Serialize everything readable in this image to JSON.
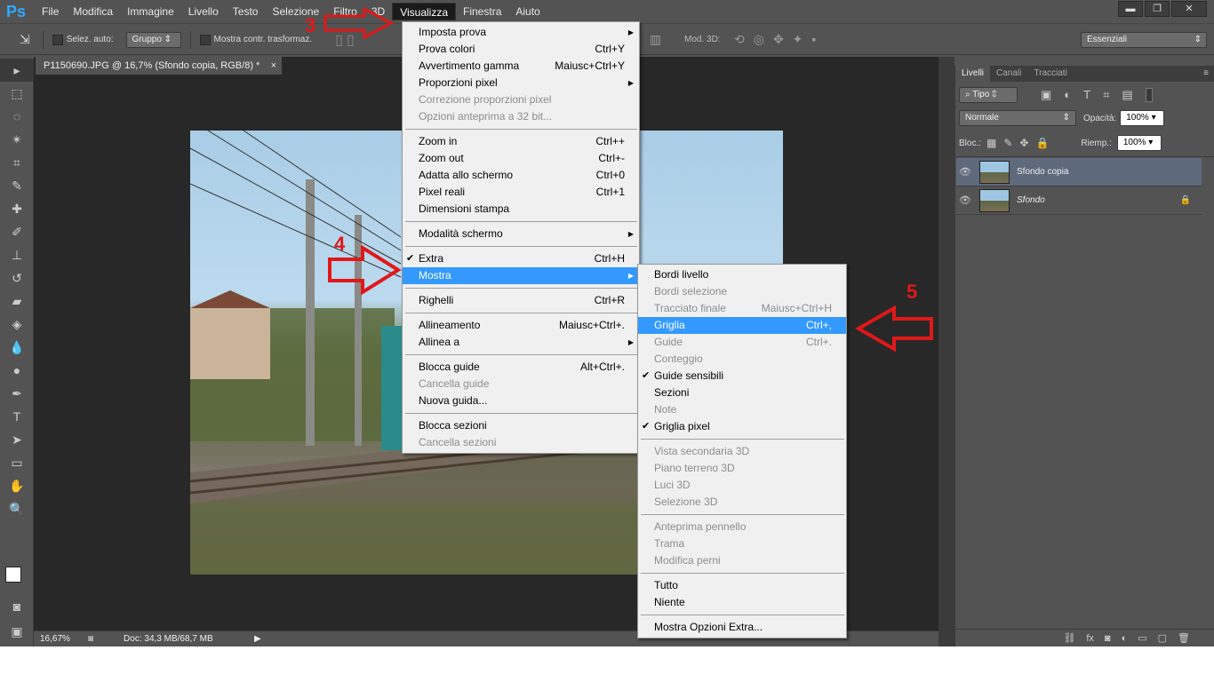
{
  "app": {
    "logo": "Ps"
  },
  "menubar": {
    "items": [
      "File",
      "Modifica",
      "Immagine",
      "Livello",
      "Testo",
      "Selezione",
      "Filtro",
      "3D",
      "Visualizza",
      "Finestra",
      "Aiuto"
    ]
  },
  "window_controls": {
    "minimize": "▬",
    "restore": "❐",
    "close": "✕"
  },
  "options_bar": {
    "auto_select_label": "Selez. auto:",
    "auto_select_value": "Gruppo",
    "show_transform_label": "Mostra contr. trasformaz.",
    "mode3d_label": "Mod. 3D:",
    "workspace": "Essenziali"
  },
  "document": {
    "tab_title": "P1150690.JPG @ 16,7% (Sfondo copia, RGB/8) *",
    "tab_close": "×"
  },
  "status": {
    "zoom": "16,67%",
    "doc": "Doc: 34,3 MB/68,7 MB"
  },
  "layers_panel": {
    "tabs": [
      "Livelli",
      "Canali",
      "Tracciati"
    ],
    "filter": "Tipo",
    "blend_mode": "Normale",
    "opacity_label": "Opacità:",
    "opacity_value": "100%",
    "lock_label": "Bloc.:",
    "fill_label": "Riemp.:",
    "fill_value": "100%",
    "layers": [
      {
        "name": "Sfondo copia"
      },
      {
        "name": "Sfondo"
      }
    ]
  },
  "view_menu": {
    "items": [
      {
        "label": "Imposta prova",
        "shortcut": "",
        "submenu": true
      },
      {
        "label": "Prova colori",
        "shortcut": "Ctrl+Y"
      },
      {
        "label": "Avvertimento gamma",
        "shortcut": "Maiusc+Ctrl+Y"
      },
      {
        "label": "Proporzioni pixel",
        "shortcut": "",
        "submenu": true
      },
      {
        "label": "Correzione proporzioni pixel",
        "shortcut": "",
        "disabled": true
      },
      {
        "label": "Opzioni anteprima a 32 bit...",
        "shortcut": "",
        "disabled": true
      },
      {
        "sep": true
      },
      {
        "label": "Zoom in",
        "shortcut": "Ctrl++"
      },
      {
        "label": "Zoom out",
        "shortcut": "Ctrl+-"
      },
      {
        "label": "Adatta allo schermo",
        "shortcut": "Ctrl+0"
      },
      {
        "label": "Pixel reali",
        "shortcut": "Ctrl+1"
      },
      {
        "label": "Dimensioni stampa",
        "shortcut": ""
      },
      {
        "sep": true
      },
      {
        "label": "Modalità schermo",
        "shortcut": "",
        "submenu": true
      },
      {
        "sep": true
      },
      {
        "label": "Extra",
        "shortcut": "Ctrl+H",
        "checked": true
      },
      {
        "label": "Mostra",
        "shortcut": "",
        "submenu": true,
        "highlighted": true
      },
      {
        "sep": true
      },
      {
        "label": "Righelli",
        "shortcut": "Ctrl+R"
      },
      {
        "sep": true
      },
      {
        "label": "Allineamento",
        "shortcut": "Maiusc+Ctrl+."
      },
      {
        "label": "Allinea a",
        "shortcut": "",
        "submenu": true
      },
      {
        "sep": true
      },
      {
        "label": "Blocca guide",
        "shortcut": "Alt+Ctrl+."
      },
      {
        "label": "Cancella guide",
        "shortcut": "",
        "disabled": true
      },
      {
        "label": "Nuova guida...",
        "shortcut": ""
      },
      {
        "sep": true
      },
      {
        "label": "Blocca sezioni",
        "shortcut": ""
      },
      {
        "label": "Cancella sezioni",
        "shortcut": "",
        "disabled": true
      }
    ]
  },
  "show_submenu": {
    "items": [
      {
        "label": "Bordi livello",
        "shortcut": ""
      },
      {
        "label": "Bordi selezione",
        "shortcut": "",
        "disabled": true
      },
      {
        "label": "Tracciato finale",
        "shortcut": "Maiusc+Ctrl+H",
        "disabled": true
      },
      {
        "label": "Griglia",
        "shortcut": "Ctrl+,",
        "highlighted": true
      },
      {
        "label": "Guide",
        "shortcut": "Ctrl+.",
        "disabled": true
      },
      {
        "label": "Conteggio",
        "shortcut": "",
        "disabled": true
      },
      {
        "label": "Guide sensibili",
        "shortcut": "",
        "checked": true
      },
      {
        "label": "Sezioni",
        "shortcut": ""
      },
      {
        "label": "Note",
        "shortcut": "",
        "disabled": true
      },
      {
        "label": "Griglia pixel",
        "shortcut": "",
        "checked": true
      },
      {
        "sep": true
      },
      {
        "label": "Vista secondaria 3D",
        "shortcut": "",
        "disabled": true
      },
      {
        "label": "Piano terreno 3D",
        "shortcut": "",
        "disabled": true
      },
      {
        "label": "Luci 3D",
        "shortcut": "",
        "disabled": true
      },
      {
        "label": "Selezione 3D",
        "shortcut": "",
        "disabled": true
      },
      {
        "sep": true
      },
      {
        "label": "Anteprima pennello",
        "shortcut": "",
        "disabled": true
      },
      {
        "label": "Trama",
        "shortcut": "",
        "disabled": true
      },
      {
        "label": "Modifica perni",
        "shortcut": "",
        "disabled": true
      },
      {
        "sep": true
      },
      {
        "label": "Tutto",
        "shortcut": ""
      },
      {
        "label": "Niente",
        "shortcut": ""
      },
      {
        "sep": true
      },
      {
        "label": "Mostra Opzioni Extra...",
        "shortcut": ""
      }
    ]
  },
  "annotations": {
    "step3": "3",
    "step4": "4",
    "step5": "5",
    "color": "#e01818"
  },
  "colors": {
    "highlight": "#3399ff",
    "ui_bg": "#535353",
    "canvas_bg": "#282828"
  }
}
